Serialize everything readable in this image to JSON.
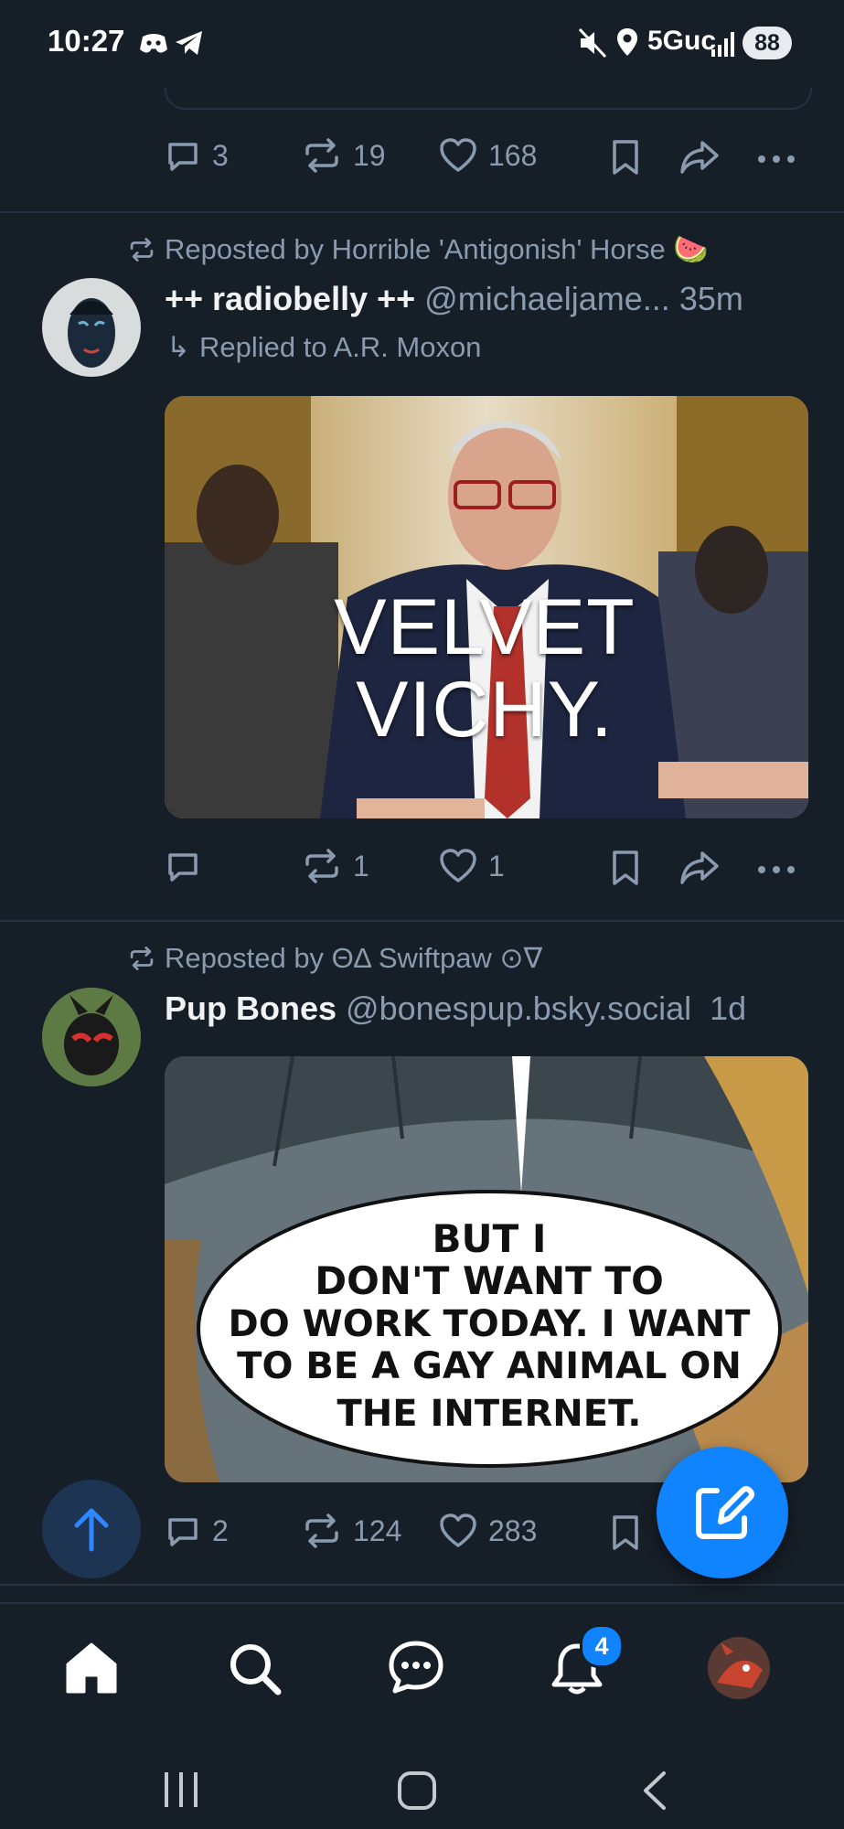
{
  "status_bar": {
    "time": "10:27",
    "network": "5Guc",
    "battery": "88"
  },
  "top_post_actions": {
    "replies": "3",
    "reposts": "19",
    "likes": "168"
  },
  "posts": [
    {
      "repost_by": "Reposted by Horrible 'Antigonish' Horse 🍉",
      "display_name": "++ radiobelly ++",
      "handle": "@michaeljame...",
      "time": "35m",
      "reply_to": "Replied to A.R. Moxon",
      "image_text": [
        "VELVET",
        "VICHY."
      ],
      "replies": "",
      "reposts": "1",
      "likes": "1"
    },
    {
      "repost_by": "Reposted by ΘΔ Swiftpaw ⊙∇",
      "display_name": "Pup Bones",
      "handle": "@bonespup.bsky.social",
      "time": "1d",
      "image_text": [
        "BUT I",
        "DON'T WANT TO",
        "DO WORK TODAY. I WANT",
        "TO BE A GAY ANIMAL ON",
        "THE INTERNET."
      ],
      "replies": "2",
      "reposts": "124",
      "likes": "283"
    }
  ],
  "nav": {
    "notifications_badge": "4"
  },
  "colors": {
    "background": "#161e27",
    "accent": "#1083fe",
    "muted": "#8a9bb0",
    "like_pink": "#ec4899"
  }
}
